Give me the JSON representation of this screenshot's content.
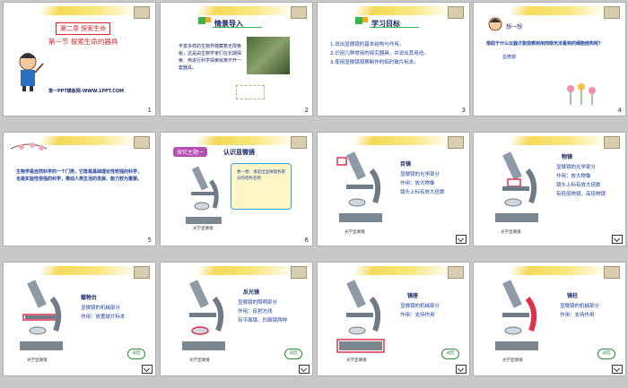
{
  "slides": [
    {
      "num": "1",
      "chapter": "第二章  探索生命",
      "title": "第一节  探索生命的器具",
      "footer": "第一PPT模板网-WWW.1PPT.COM"
    },
    {
      "num": "2",
      "heading": "情景导入",
      "text": "丰富多样的生物界蕴藏着无限奥秘，这是由生物学家们在长期探索、用进行科学探索就离不开一套器具。"
    },
    {
      "num": "3",
      "heading": "学习目标",
      "items": [
        "1.说出显微镜的基本结构与作用。",
        "2.识别几种常用的探究器具，并说出其用途。",
        "3.使用显微镜观察制作的临时玻片标本。"
      ]
    },
    {
      "num": "4",
      "heading": "想一想",
      "question": "借助于什么仪器才能观察到用肉眼无法看到的细胞结构呢？",
      "answer": "显微镜"
    },
    {
      "num": "5",
      "text": "生物学是自然科学的一个门类，它既是基础理论性较强的科学，也是实验性很强的科学，推动人类生活的发展、能力较为重要。"
    },
    {
      "num": "6",
      "theme": "探究主题一",
      "theme_title": "认识显微镜",
      "bubble": "想一想：请说出显微镜各部分的结构名称",
      "caption": "光学显微镜"
    },
    {
      "num": "",
      "label": "目镜",
      "items": [
        "显微镜的光学部分",
        "作用：放大物像",
        "镜头上标有放大倍数"
      ],
      "caption": "光学显微镜"
    },
    {
      "num": "",
      "label": "物镜",
      "items": [
        "显微镜的光学部分",
        "作用：放大物像",
        "镜头上标有放大倍数",
        "有低倍物镜、高倍物镜"
      ],
      "caption": "光学显微镜"
    },
    {
      "num": "",
      "label": "载物台",
      "items": [
        "显微镜的机械部分",
        "作用：放置玻片标本"
      ],
      "caption": "光学显微镜",
      "btn": "返回"
    },
    {
      "num": "",
      "label": "反光镜",
      "items": [
        "显微镜的照明部分",
        "作用：反射光线",
        "有平面镜、凹面镜两种"
      ],
      "caption": "光学显微镜",
      "btn": "返回"
    },
    {
      "num": "",
      "label": "镜座",
      "items": [
        "显微镜的机械部分",
        "作用：支持作用"
      ],
      "caption": "光学显微镜",
      "btn": "返回"
    },
    {
      "num": "",
      "label": "镜柱",
      "items": [
        "显微镜的机械部分",
        "作用：支持作用"
      ],
      "caption": "光学显微镜",
      "btn": "返回"
    }
  ]
}
